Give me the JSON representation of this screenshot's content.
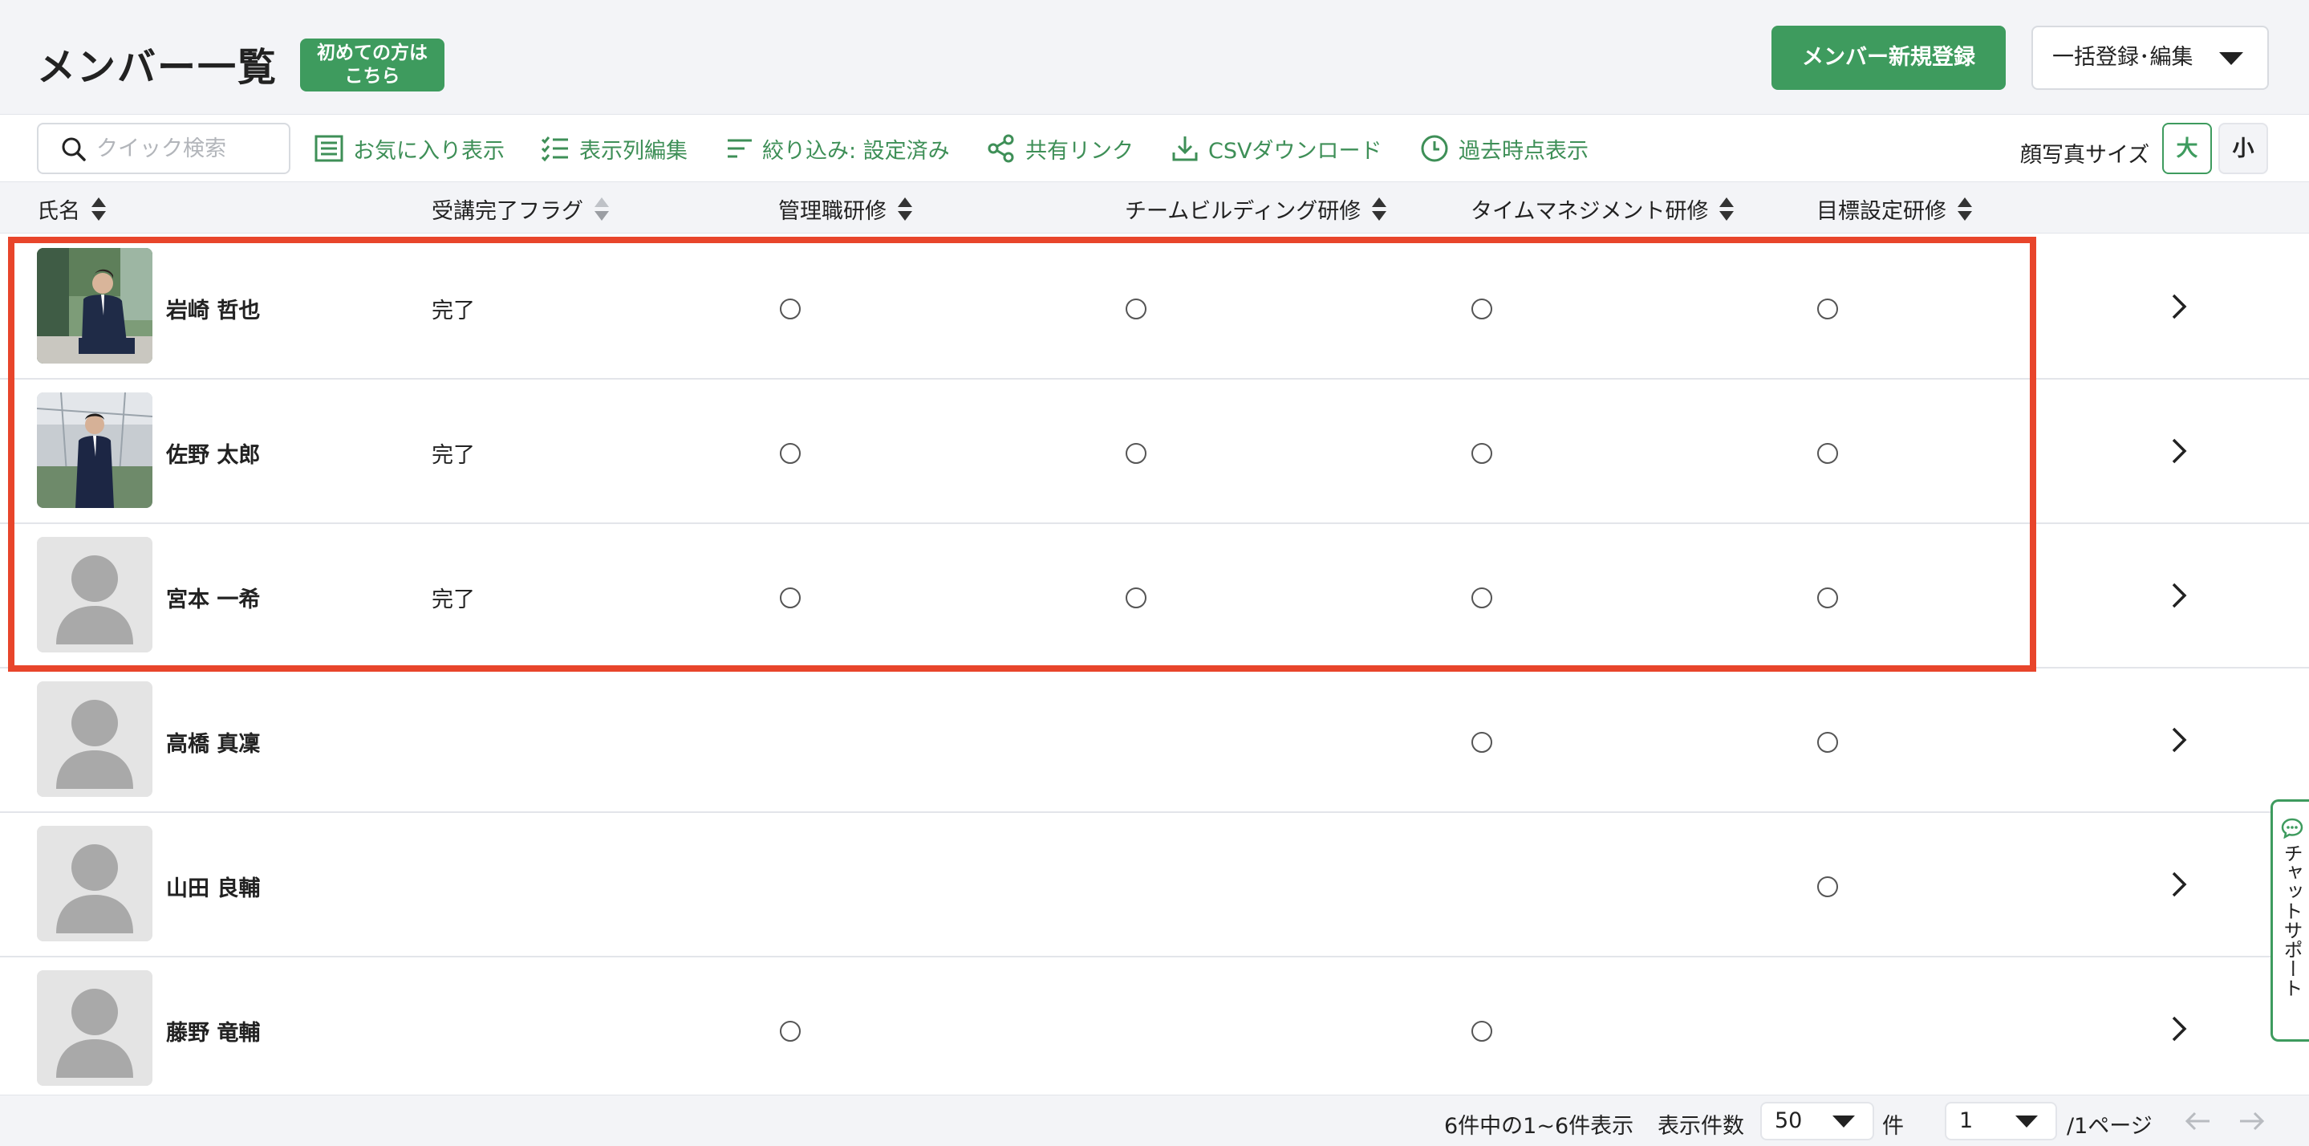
{
  "header": {
    "title": "メンバー一覧",
    "first_time_badge": [
      "初めての方は",
      "こちら"
    ],
    "new_member_button": "メンバー新規登録",
    "bulk_button": "一括登録･編集"
  },
  "toolbar": {
    "search_placeholder": "クイック検索",
    "favorites": "お気に入り表示",
    "edit_columns": "表示列編集",
    "filter": "絞り込み: 設定済み",
    "share_link": "共有リンク",
    "csv_download": "CSVダウンロード",
    "past_view": "過去時点表示",
    "photo_size_label": "顔写真サイズ",
    "photo_size_large": "大",
    "photo_size_small": "小"
  },
  "table": {
    "columns": [
      "氏名",
      "受講完了フラグ",
      "管理職研修",
      "チームビルディング研修",
      "タイムマネジメント研修",
      "目標設定研修"
    ],
    "circle_symbol": "○",
    "rows": [
      {
        "name": "岩崎 哲也",
        "flag": "完了",
        "avatar": "photo-man-sitting",
        "marks": [
          true,
          true,
          true,
          true
        ]
      },
      {
        "name": "佐野 太郎",
        "flag": "完了",
        "avatar": "photo-man-standing",
        "marks": [
          true,
          true,
          true,
          true
        ]
      },
      {
        "name": "宮本 一希",
        "flag": "完了",
        "avatar": "placeholder",
        "marks": [
          true,
          true,
          true,
          true
        ]
      },
      {
        "name": "高橋 真凜",
        "flag": "",
        "avatar": "placeholder",
        "marks": [
          false,
          false,
          true,
          true
        ]
      },
      {
        "name": "山田 良輔",
        "flag": "",
        "avatar": "placeholder",
        "marks": [
          false,
          false,
          false,
          true
        ]
      },
      {
        "name": "藤野 竜輔",
        "flag": "",
        "avatar": "placeholder",
        "marks": [
          true,
          false,
          true,
          false
        ]
      }
    ]
  },
  "footer": {
    "summary": "6件中の1~6件表示",
    "per_page_label": "表示件数",
    "per_page_value": "50",
    "per_page_unit": "件",
    "page_value": "1",
    "page_suffix": "/1ページ"
  },
  "chat": {
    "label": "チャットサポート"
  },
  "colors": {
    "accent": "#3e9b5e",
    "highlight": "#e8452b",
    "header_bg": "#f3f4f7"
  }
}
